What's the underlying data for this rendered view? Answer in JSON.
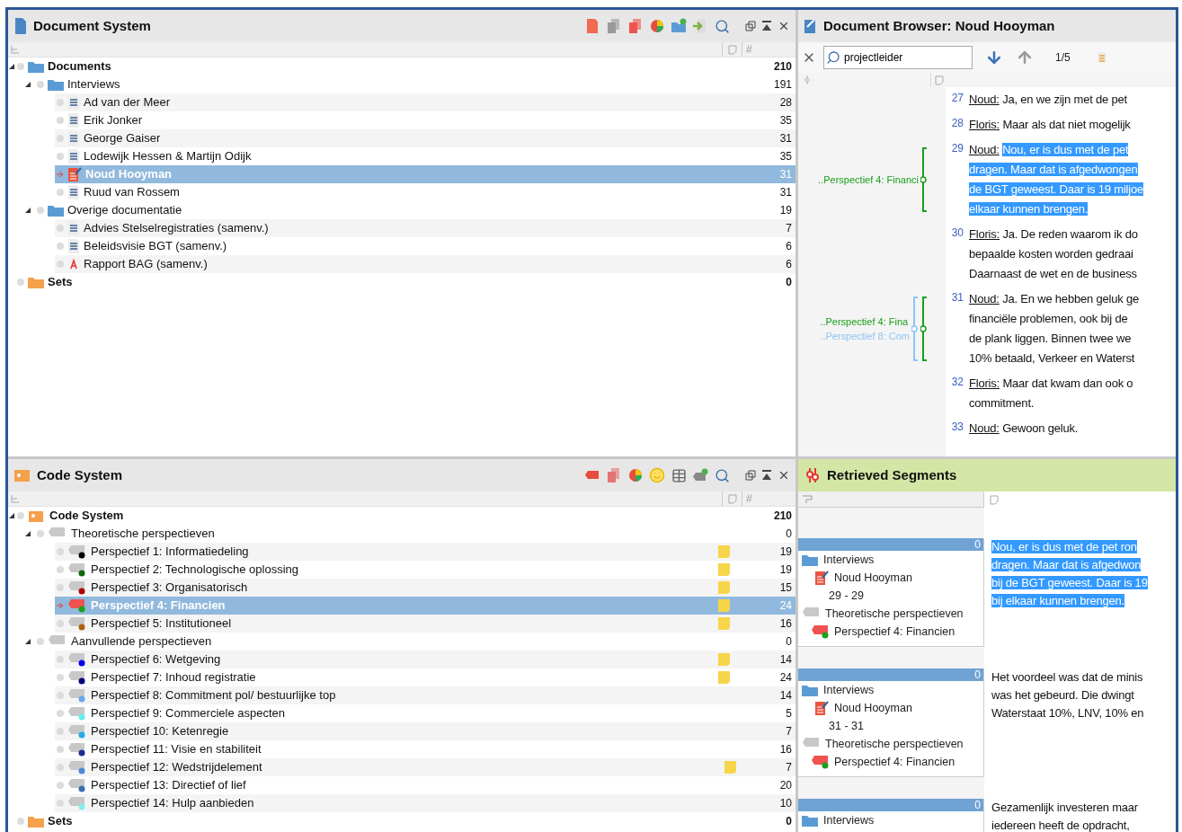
{
  "document_system": {
    "title": "Document System",
    "count_header": "#",
    "tree": [
      {
        "label": "Documents",
        "kind": "root",
        "count": "210",
        "expanded": true,
        "selected": false,
        "children": [
          {
            "label": "Interviews",
            "kind": "folder",
            "count": "191",
            "expanded": true,
            "selected": false,
            "children": [
              {
                "label": "Ad van der Meer",
                "kind": "text",
                "count": "28",
                "selected": false
              },
              {
                "label": "Erik Jonker",
                "kind": "text",
                "count": "35",
                "selected": false
              },
              {
                "label": "George Gaiser",
                "kind": "text",
                "count": "31",
                "selected": false
              },
              {
                "label": "Lodewijk Hessen & Martijn Odijk",
                "kind": "text",
                "count": "35",
                "selected": false
              },
              {
                "label": "Noud Hooyman",
                "kind": "open",
                "count": "31",
                "selected": true
              },
              {
                "label": "Ruud van Rossem",
                "kind": "text",
                "count": "31",
                "selected": false
              }
            ]
          },
          {
            "label": "Overige documentatie",
            "kind": "folder",
            "count": "19",
            "expanded": true,
            "selected": false,
            "children": [
              {
                "label": "Advies Stelselregistraties (samenv.)",
                "kind": "text",
                "count": "7",
                "selected": false
              },
              {
                "label": "Beleidsvisie BGT (samenv.)",
                "kind": "text",
                "count": "6",
                "selected": false
              },
              {
                "label": "Rapport BAG (samenv.)",
                "kind": "pdf",
                "count": "6",
                "selected": false
              }
            ]
          }
        ]
      },
      {
        "label": "Sets",
        "kind": "sets",
        "count": "0",
        "selected": false
      }
    ]
  },
  "document_browser": {
    "title": "Document Browser: Noud Hooyman",
    "search": {
      "value": "projectleider"
    },
    "hit_counter": "1/5",
    "paragraphs": [
      {
        "number": "27",
        "speaker": "Noud:",
        "lines": [
          "Ja, en we zijn met de pet"
        ],
        "highlighted": false
      },
      {
        "number": "28",
        "speaker": "Floris:",
        "lines": [
          "Maar als dat niet mogelijk"
        ],
        "highlighted": false
      },
      {
        "number": "29",
        "speaker": "Noud:",
        "lines": [
          "Nou, er is dus met de pet",
          "dragen. Maar dat is afgedwongen",
          "de BGT geweest. Daar is 19 miljoe",
          "elkaar kunnen brengen."
        ],
        "highlighted": true,
        "codes": [
          {
            "label": "..Perspectief 4: Financi",
            "color": "#1aa01a"
          }
        ]
      },
      {
        "number": "30",
        "speaker": "Floris:",
        "lines": [
          "Ja. De reden waarom ik do",
          "bepaalde kosten worden gedraai",
          "Daarnaast de wet en de business"
        ],
        "highlighted": false
      },
      {
        "number": "31",
        "speaker": "Noud:",
        "lines": [
          "Ja. En we hebben geluk ge",
          "financiële problemen, ook bij de",
          "de plank liggen. Binnen twee we",
          "10% betaald, Verkeer en Waterst"
        ],
        "highlighted": false,
        "codes": [
          {
            "label": "..Perspectief 4: Fina",
            "color": "#1aa01a"
          },
          {
            "label": "..Perspectief 8: Com",
            "color": "#8fc3f5"
          }
        ]
      },
      {
        "number": "32",
        "speaker": "Floris:",
        "lines": [
          "Maar dat kwam dan ook o",
          "commitment."
        ],
        "highlighted": false
      },
      {
        "number": "33",
        "speaker": "Noud:",
        "lines": [
          "Gewoon geluk."
        ],
        "highlighted": false
      }
    ]
  },
  "code_system": {
    "title": "Code System",
    "count_header": "#",
    "tree": [
      {
        "label": "Code System",
        "kind": "root",
        "count": "210",
        "expanded": true,
        "selected": false,
        "children": [
          {
            "label": "Theoretische perspectieven",
            "kind": "group",
            "count": "0",
            "expanded": true,
            "selected": false,
            "children": [
              {
                "label": "Perspectief 1: Informatiedeling",
                "kind": "code",
                "color": "#000000",
                "memo": true,
                "count": "19",
                "selected": false
              },
              {
                "label": "Perspectief 2: Technologische oplossing",
                "kind": "code",
                "color": "#0b6b0b",
                "memo": true,
                "count": "19",
                "selected": false
              },
              {
                "label": "Perspectief 3: Organisatorisch",
                "kind": "code",
                "color": "#b00000",
                "memo": true,
                "count": "15",
                "selected": false
              },
              {
                "label": "Perspectief 4: Financien",
                "kind": "code",
                "color": "#1aa01a",
                "memo": true,
                "count": "24",
                "selected": true
              },
              {
                "label": "Perspectief 5: Institutioneel",
                "kind": "code",
                "color": "#b06010",
                "memo": true,
                "count": "16",
                "selected": false
              }
            ]
          },
          {
            "label": "Aanvullende perspectieven",
            "kind": "group",
            "count": "0",
            "expanded": true,
            "selected": false,
            "children": [
              {
                "label": "Perspectief 6: Wetgeving",
                "kind": "code",
                "color": "#0000ee",
                "memo": true,
                "count": "14",
                "selected": false
              },
              {
                "label": "Perspectief 7: Inhoud registratie",
                "kind": "code",
                "color": "#000080",
                "memo": true,
                "count": "24",
                "selected": false
              },
              {
                "label": "Perspectief 8: Commitment pol/ bestuurlijke top",
                "kind": "code",
                "color": "#66aaee",
                "memo": false,
                "count": "14",
                "selected": false
              },
              {
                "label": "Perspectief 9: Commerciele aspecten",
                "kind": "code",
                "color": "#66eeee",
                "memo": false,
                "count": "5",
                "selected": false
              },
              {
                "label": "Perspectief 10: Ketenregie",
                "kind": "code",
                "color": "#22aaee",
                "memo": false,
                "count": "7",
                "selected": false
              },
              {
                "label": "Perspectief 11: Visie en stabiliteit",
                "kind": "code",
                "color": "#1a2a9a",
                "memo": false,
                "count": "16",
                "selected": false
              },
              {
                "label": "Perspectief 12: Wedstrijdelement",
                "kind": "code",
                "color": "#4a8ad8",
                "memo": true,
                "count": "7",
                "selected": false
              },
              {
                "label": "Perspectief 13: Directief of lief",
                "kind": "code",
                "color": "#3a70b0",
                "memo": false,
                "count": "20",
                "selected": false
              },
              {
                "label": "Perspectief 14: Hulp aanbieden",
                "kind": "code",
                "color": "#88eeee",
                "memo": false,
                "count": "10",
                "selected": false
              }
            ]
          }
        ]
      },
      {
        "label": "Sets",
        "kind": "sets",
        "count": "0",
        "selected": false
      }
    ]
  },
  "retrieved_segments": {
    "title": "Retrieved Segments",
    "segments": [
      {
        "count": "0",
        "folder": "Interviews",
        "document": "Noud Hooyman",
        "range": "29 - 29",
        "code_group": "Theoretische perspectieven",
        "code": "Perspectief 4: Financien",
        "color": "#1aa01a",
        "lines": [
          "Nou, er is dus met de pet ron",
          "dragen. Maar dat is afgedwon",
          "bij de BGT geweest. Daar is 19",
          "bij elkaar kunnen brengen."
        ],
        "highlighted": true
      },
      {
        "count": "0",
        "folder": "Interviews",
        "document": "Noud Hooyman",
        "range": "31 - 31",
        "code_group": "Theoretische perspectieven",
        "code": "Perspectief 4: Financien",
        "color": "#1aa01a",
        "lines": [
          "Het voordeel was dat de minis",
          "was het gebeurd. Die dwingt",
          "Waterstaat 10%, LNV, 10% en"
        ],
        "highlighted": false
      },
      {
        "count": "0",
        "folder": "Interviews",
        "lines": [
          "Gezamenlijk investeren maar",
          "iedereen heeft de opdracht,"
        ],
        "highlighted": false
      }
    ]
  }
}
